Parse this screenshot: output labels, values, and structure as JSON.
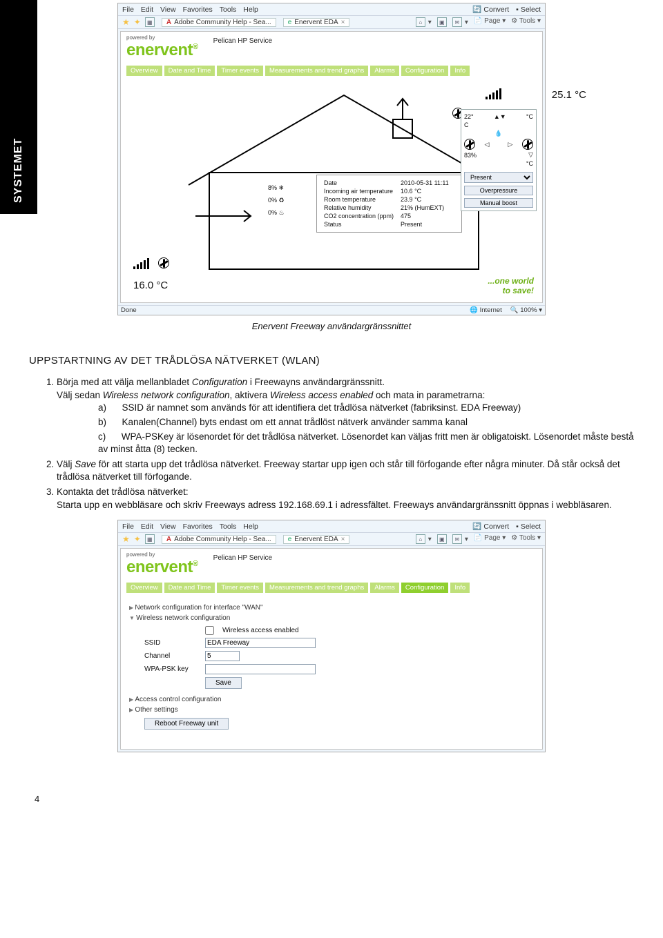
{
  "side_tab": "SYSTEMET",
  "browser1": {
    "menu": [
      "File",
      "Edit",
      "View",
      "Favorites",
      "Tools",
      "Help"
    ],
    "convert": "Convert",
    "select": "Select",
    "tabs": [
      {
        "icon": "A",
        "label": "Adobe Community Help - Sea..."
      },
      {
        "icon": "e",
        "label": "Enervent EDA",
        "close": "×"
      }
    ],
    "right_tools": [
      "Page",
      "Tools"
    ],
    "powered": "powered by",
    "logo": "enervent",
    "service": "Pelican HP Service",
    "nav": [
      "Overview",
      "Date and Time",
      "Timer events",
      "Measurements and trend graphs",
      "Alarms",
      "Configuration",
      "Info"
    ],
    "exhaust_temp": "25.1 °C",
    "intake_temp": "16.0 °C",
    "pct8": "8%",
    "pct0a": "0%",
    "pct0b": "0%",
    "status_rows": [
      [
        "Date",
        "2010-05-31 11:11"
      ],
      [
        "Incoming air temperature",
        "10.6 °C"
      ],
      [
        "Room temperature",
        "23.9 °C"
      ],
      [
        "Relative humidity",
        "21% (HumEXT)"
      ],
      [
        "CO2 concentration (ppm)",
        "475"
      ],
      [
        "Status",
        "Present"
      ]
    ],
    "side": {
      "temp": "22°",
      "unit_c": "C",
      "unit_tc": "°C",
      "pct": "83%",
      "unit_tc2": "°C",
      "present_options": [
        "Present"
      ],
      "overpressure": "Overpressure",
      "manual": "Manual boost"
    },
    "slogan1": "...one world",
    "slogan2": "to save!",
    "status_done": "Done",
    "status_net": "Internet",
    "status_zoom": "100%"
  },
  "caption": "Enervent Freeway  användargränssnittet",
  "section_title": "UPPSTARTNING AV DET TRÅDLÖSA NÄTVERKET (WLAN)",
  "body": {
    "li1_pre": "Börja med att välja mellanbladet ",
    "li1_em": "Configuration",
    "li1_post": " i Freewayns användargränssnitt.",
    "li1b_pre": "Välj sedan ",
    "li1b_em1": "Wireless network configuration",
    "li1b_mid": ", aktivera ",
    "li1b_em2": "Wireless access enabled",
    "li1b_post": " och mata in parametrarna:",
    "a": "SSID är namnet som används för att identifiera det trådlösa nätverket (fabriksinst. EDA Freeway)",
    "b": "Kanalen(Channel) byts endast om ett annat trådlöst nätverk använder samma kanal",
    "c": "WPA-PSKey är lösenordet för det trådlösa nätverket. Lösenordet kan väljas fritt men är obligatoiskt. Lösenordet måste bestå av minst åtta (8) tecken.",
    "li2_pre": "Välj ",
    "li2_em": "Save",
    "li2_post": " för att starta upp det trådlösa nätverket. Freeway startar upp igen och står till förfogande efter några minuter. Då står också det trådlösa nätverket till förfogande.",
    "li3_head": "Kontakta det trådlösa nätverket:",
    "li3_body": "Starta upp en webbläsare och skriv Freeways adress 192.168.69.1 i adressfältet. Freeways användargränssnitt öppnas i webbläsaren."
  },
  "browser2": {
    "cfg_nav_active": "Configuration",
    "items": {
      "wan": "Network configuration for interface \"WAN\"",
      "wlan": "Wireless network configuration",
      "chk_label": "Wireless access enabled",
      "ssid_label": "SSID",
      "ssid_value": "EDA Freeway",
      "channel_label": "Channel",
      "channel_value": "5",
      "wpa_label": "WPA-PSK key",
      "wpa_value": "",
      "save": "Save",
      "acc": "Access control configuration",
      "other": "Other settings",
      "reboot": "Reboot Freeway unit"
    }
  },
  "page_number": "4"
}
